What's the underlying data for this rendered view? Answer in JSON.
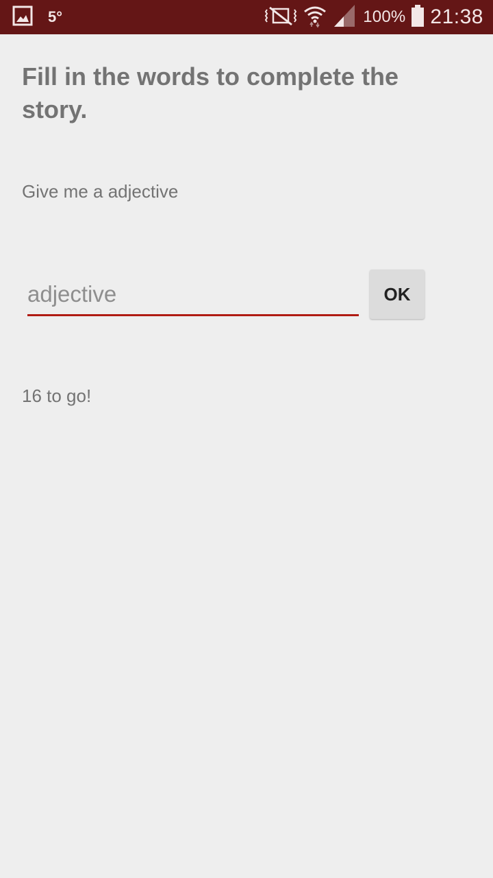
{
  "status_bar": {
    "temperature": "5°",
    "battery": "100%",
    "time": "21:38",
    "icons": [
      "gallery-icon",
      "vibrate-icon",
      "wifi-icon",
      "signal-icon",
      "battery-icon"
    ]
  },
  "screen": {
    "title": "Fill in the words to complete the story.",
    "prompt": "Give me a adjective",
    "input_value": "",
    "input_placeholder": "adjective",
    "ok_label": "OK",
    "remaining": "16 to go!"
  },
  "colors": {
    "status_bar": "#641616",
    "background": "#eeeeee",
    "accent": "#b01a12",
    "button": "#dcdcdc",
    "text": "#737373"
  }
}
